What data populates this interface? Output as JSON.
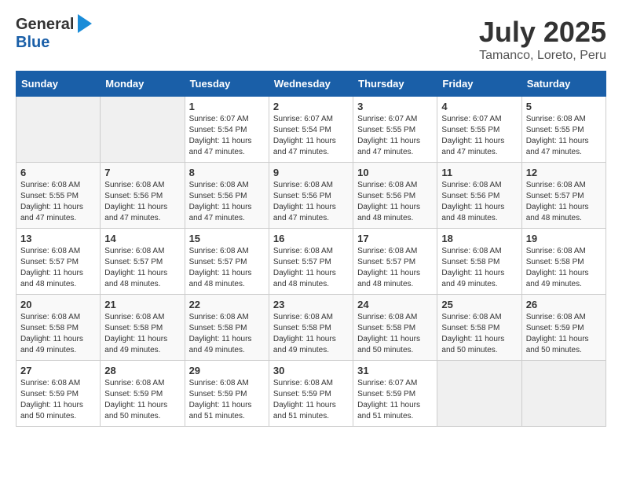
{
  "logo": {
    "general": "General",
    "blue": "Blue"
  },
  "title": "July 2025",
  "subtitle": "Tamanco, Loreto, Peru",
  "headers": [
    "Sunday",
    "Monday",
    "Tuesday",
    "Wednesday",
    "Thursday",
    "Friday",
    "Saturday"
  ],
  "weeks": [
    [
      {
        "day": "",
        "info": ""
      },
      {
        "day": "",
        "info": ""
      },
      {
        "day": "1",
        "info": "Sunrise: 6:07 AM\nSunset: 5:54 PM\nDaylight: 11 hours and 47 minutes."
      },
      {
        "day": "2",
        "info": "Sunrise: 6:07 AM\nSunset: 5:54 PM\nDaylight: 11 hours and 47 minutes."
      },
      {
        "day": "3",
        "info": "Sunrise: 6:07 AM\nSunset: 5:55 PM\nDaylight: 11 hours and 47 minutes."
      },
      {
        "day": "4",
        "info": "Sunrise: 6:07 AM\nSunset: 5:55 PM\nDaylight: 11 hours and 47 minutes."
      },
      {
        "day": "5",
        "info": "Sunrise: 6:08 AM\nSunset: 5:55 PM\nDaylight: 11 hours and 47 minutes."
      }
    ],
    [
      {
        "day": "6",
        "info": "Sunrise: 6:08 AM\nSunset: 5:55 PM\nDaylight: 11 hours and 47 minutes."
      },
      {
        "day": "7",
        "info": "Sunrise: 6:08 AM\nSunset: 5:56 PM\nDaylight: 11 hours and 47 minutes."
      },
      {
        "day": "8",
        "info": "Sunrise: 6:08 AM\nSunset: 5:56 PM\nDaylight: 11 hours and 47 minutes."
      },
      {
        "day": "9",
        "info": "Sunrise: 6:08 AM\nSunset: 5:56 PM\nDaylight: 11 hours and 47 minutes."
      },
      {
        "day": "10",
        "info": "Sunrise: 6:08 AM\nSunset: 5:56 PM\nDaylight: 11 hours and 48 minutes."
      },
      {
        "day": "11",
        "info": "Sunrise: 6:08 AM\nSunset: 5:56 PM\nDaylight: 11 hours and 48 minutes."
      },
      {
        "day": "12",
        "info": "Sunrise: 6:08 AM\nSunset: 5:57 PM\nDaylight: 11 hours and 48 minutes."
      }
    ],
    [
      {
        "day": "13",
        "info": "Sunrise: 6:08 AM\nSunset: 5:57 PM\nDaylight: 11 hours and 48 minutes."
      },
      {
        "day": "14",
        "info": "Sunrise: 6:08 AM\nSunset: 5:57 PM\nDaylight: 11 hours and 48 minutes."
      },
      {
        "day": "15",
        "info": "Sunrise: 6:08 AM\nSunset: 5:57 PM\nDaylight: 11 hours and 48 minutes."
      },
      {
        "day": "16",
        "info": "Sunrise: 6:08 AM\nSunset: 5:57 PM\nDaylight: 11 hours and 48 minutes."
      },
      {
        "day": "17",
        "info": "Sunrise: 6:08 AM\nSunset: 5:57 PM\nDaylight: 11 hours and 48 minutes."
      },
      {
        "day": "18",
        "info": "Sunrise: 6:08 AM\nSunset: 5:58 PM\nDaylight: 11 hours and 49 minutes."
      },
      {
        "day": "19",
        "info": "Sunrise: 6:08 AM\nSunset: 5:58 PM\nDaylight: 11 hours and 49 minutes."
      }
    ],
    [
      {
        "day": "20",
        "info": "Sunrise: 6:08 AM\nSunset: 5:58 PM\nDaylight: 11 hours and 49 minutes."
      },
      {
        "day": "21",
        "info": "Sunrise: 6:08 AM\nSunset: 5:58 PM\nDaylight: 11 hours and 49 minutes."
      },
      {
        "day": "22",
        "info": "Sunrise: 6:08 AM\nSunset: 5:58 PM\nDaylight: 11 hours and 49 minutes."
      },
      {
        "day": "23",
        "info": "Sunrise: 6:08 AM\nSunset: 5:58 PM\nDaylight: 11 hours and 49 minutes."
      },
      {
        "day": "24",
        "info": "Sunrise: 6:08 AM\nSunset: 5:58 PM\nDaylight: 11 hours and 50 minutes."
      },
      {
        "day": "25",
        "info": "Sunrise: 6:08 AM\nSunset: 5:58 PM\nDaylight: 11 hours and 50 minutes."
      },
      {
        "day": "26",
        "info": "Sunrise: 6:08 AM\nSunset: 5:59 PM\nDaylight: 11 hours and 50 minutes."
      }
    ],
    [
      {
        "day": "27",
        "info": "Sunrise: 6:08 AM\nSunset: 5:59 PM\nDaylight: 11 hours and 50 minutes."
      },
      {
        "day": "28",
        "info": "Sunrise: 6:08 AM\nSunset: 5:59 PM\nDaylight: 11 hours and 50 minutes."
      },
      {
        "day": "29",
        "info": "Sunrise: 6:08 AM\nSunset: 5:59 PM\nDaylight: 11 hours and 51 minutes."
      },
      {
        "day": "30",
        "info": "Sunrise: 6:08 AM\nSunset: 5:59 PM\nDaylight: 11 hours and 51 minutes."
      },
      {
        "day": "31",
        "info": "Sunrise: 6:07 AM\nSunset: 5:59 PM\nDaylight: 11 hours and 51 minutes."
      },
      {
        "day": "",
        "info": ""
      },
      {
        "day": "",
        "info": ""
      }
    ]
  ]
}
